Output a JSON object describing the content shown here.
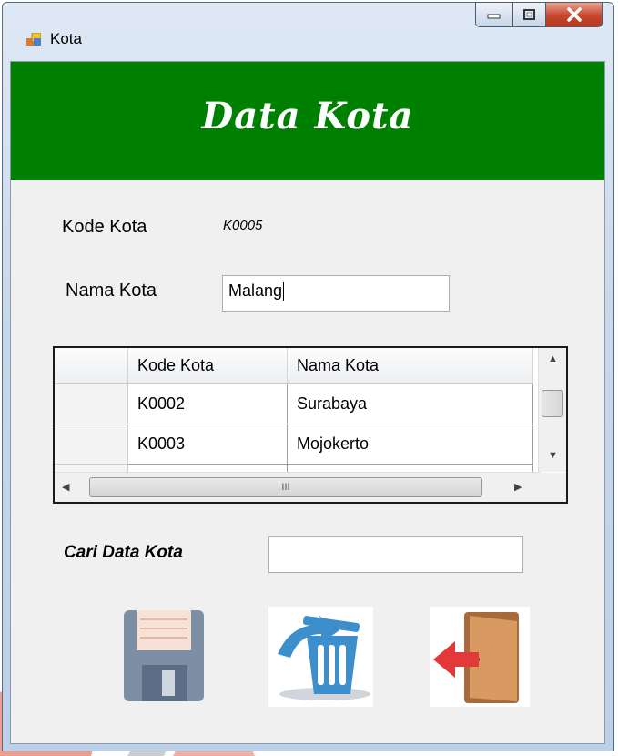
{
  "window": {
    "title": "Kota"
  },
  "header": {
    "title": "Data Kota"
  },
  "form": {
    "kode_label": "Kode Kota",
    "kode_value": "K0005",
    "nama_label": "Nama Kota",
    "nama_value": "Malang",
    "search_label": "Cari Data Kota",
    "search_value": ""
  },
  "grid": {
    "columns": [
      "Kode Kota",
      "Nama Kota"
    ],
    "rows": [
      [
        "K0002",
        "Surabaya"
      ],
      [
        "K0003",
        "Mojokerto"
      ]
    ],
    "hscroll_grip": "III"
  },
  "actions": [
    {
      "name": "save",
      "icon": "floppy-disk-icon"
    },
    {
      "name": "delete",
      "icon": "trash-can-icon"
    },
    {
      "name": "exit",
      "icon": "exit-door-icon"
    }
  ],
  "colors": {
    "header_bg": "#008000",
    "header_text": "#ffffff",
    "form_bg": "#f0f0f0"
  }
}
